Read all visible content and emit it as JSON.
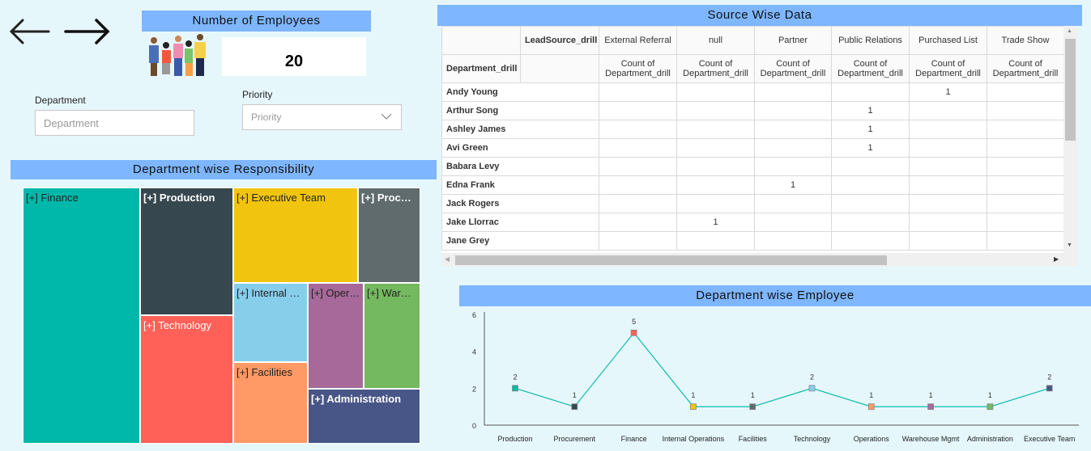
{
  "nav": {
    "back_icon": "arrow-left-icon",
    "forward_icon": "arrow-right-icon"
  },
  "kpi": {
    "title": "Number of Employees",
    "value": "20",
    "image": "people-group-illustration"
  },
  "filters": {
    "department": {
      "label": "Department",
      "placeholder": "Department"
    },
    "priority": {
      "label": "Priority",
      "placeholder": "Priority",
      "icon": "chevron-down-icon"
    }
  },
  "treemap": {
    "title": "Department wise Responsibility",
    "items": [
      {
        "label": "[+] Finance",
        "color": "#00b8a9"
      },
      {
        "label": "[+] Production",
        "color": "#37474f"
      },
      {
        "label": "[+] Technology",
        "color": "#ff6158"
      },
      {
        "label": "[+] Executive Team",
        "color": "#f1c40f"
      },
      {
        "label": "[+] Procurement",
        "color": "#5f6b6d"
      },
      {
        "label": "[+] Internal Operations",
        "color": "#87ceeb"
      },
      {
        "label": "[+] Facilities",
        "color": "#ff9966"
      },
      {
        "label": "[+] Operations",
        "color": "#a66999"
      },
      {
        "label": "[+] Warehouse Mgmt",
        "color": "#74b85f"
      },
      {
        "label": "[+] Administration",
        "color": "#485687"
      }
    ]
  },
  "pivot": {
    "title": "Source Wise Data",
    "column_field": "LeadSource_drill",
    "row_field": "Department_drill",
    "columns": [
      "External Referral",
      "null",
      "Partner",
      "Public Relations",
      "Purchased List",
      "Trade Show"
    ],
    "measure": "Count of Department_drill",
    "rows": [
      {
        "name": "Andy Young",
        "values": [
          "",
          "",
          "",
          "",
          "1",
          ""
        ]
      },
      {
        "name": "Arthur Song",
        "values": [
          "",
          "",
          "",
          "1",
          "",
          ""
        ]
      },
      {
        "name": "Ashley James",
        "values": [
          "",
          "",
          "",
          "1",
          "",
          ""
        ]
      },
      {
        "name": "Avi Green",
        "values": [
          "",
          "",
          "",
          "1",
          "",
          ""
        ]
      },
      {
        "name": "Babara Levy",
        "values": [
          "",
          "",
          "",
          "",
          "",
          ""
        ]
      },
      {
        "name": "Edna Frank",
        "values": [
          "",
          "",
          "1",
          "",
          "",
          ""
        ]
      },
      {
        "name": "Jack Rogers",
        "values": [
          "",
          "",
          "",
          "",
          "",
          ""
        ]
      },
      {
        "name": "Jake Llorrac",
        "values": [
          "",
          "1",
          "",
          "",
          "",
          ""
        ]
      },
      {
        "name": "Jane Grey",
        "values": [
          "",
          "",
          "",
          "",
          "",
          ""
        ]
      }
    ]
  },
  "chart_title": "Department wise Employee",
  "chart_data": {
    "type": "line",
    "categories": [
      "Production",
      "Procurement",
      "Finance",
      "Internal Operations",
      "Facilities",
      "Technology",
      "Operations",
      "Warehouse Mgmt",
      "Administration",
      "Executive Team"
    ],
    "values": [
      2,
      1,
      5,
      1,
      1,
      2,
      1,
      1,
      1,
      2
    ],
    "marker_colors": [
      "#00b8a9",
      "#37474f",
      "#ff6158",
      "#f1c40f",
      "#5f6b6d",
      "#87ceeb",
      "#ff9966",
      "#a66999",
      "#74b85f",
      "#485687"
    ],
    "line_color": "#1fbfb0",
    "ylim": [
      0,
      6
    ],
    "yticks": [
      0,
      2,
      4,
      6
    ],
    "grid": false,
    "data_labels": true
  }
}
